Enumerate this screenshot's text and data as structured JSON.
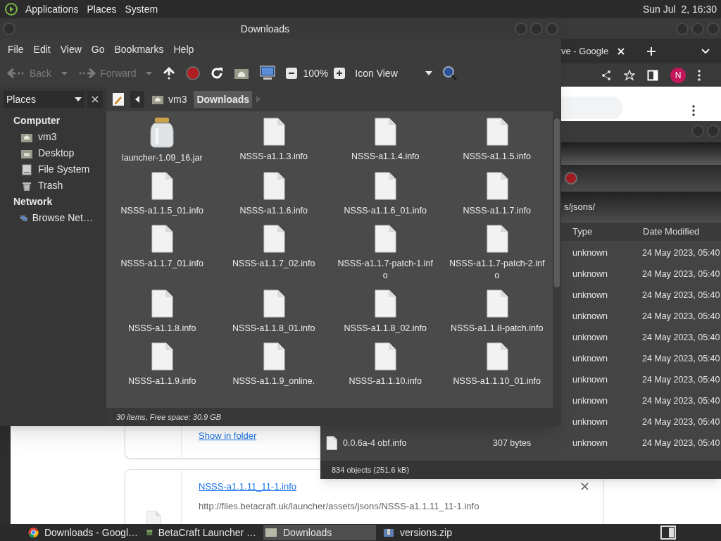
{
  "top_panel": {
    "menus": [
      "Applications",
      "Places",
      "System"
    ],
    "clock": "Sun Jul  2, 16:30"
  },
  "browser": {
    "tab_title": "ve - Google",
    "avatar": "N",
    "downloads": [
      {
        "kind": "action",
        "link": "Show in folder"
      },
      {
        "kind": "file",
        "link": "NSSS-a1.1.11_11-1.info",
        "url": "http://files.betacraft.uk/launcher/assets/jsons/NSSS-a1.1.11_11-1.info"
      }
    ]
  },
  "list_window": {
    "location": "s/jsons/",
    "columns": [
      "Type",
      "Date Modified"
    ],
    "rows": [
      {
        "type": "unknown",
        "date": "24 May 2023, 05:40"
      },
      {
        "type": "unknown",
        "date": "24 May 2023, 05:40"
      },
      {
        "type": "unknown",
        "date": "24 May 2023, 05:40"
      },
      {
        "type": "unknown",
        "date": "24 May 2023, 05:40"
      },
      {
        "type": "unknown",
        "date": "24 May 2023, 05:40"
      },
      {
        "type": "unknown",
        "date": "24 May 2023, 05:40"
      },
      {
        "type": "unknown",
        "date": "24 May 2023, 05:40"
      },
      {
        "type": "unknown",
        "date": "24 May 2023, 05:40"
      },
      {
        "type": "unknown",
        "date": "24 May 2023, 05:40"
      },
      {
        "name": "0.0.6a-4 obf.info",
        "size": "307 bytes",
        "type": "unknown",
        "date": "24 May 2023, 05:40"
      }
    ],
    "status": "834 objects (251.6 kB)"
  },
  "file_manager": {
    "title": "Downloads",
    "menus": [
      "File",
      "Edit",
      "View",
      "Go",
      "Bookmarks",
      "Help"
    ],
    "toolbar": {
      "back": {
        "label": "Back",
        "disabled": true
      },
      "forward": {
        "label": "Forward",
        "disabled": true
      },
      "zoom": "100%",
      "view": "Icon View"
    },
    "side_pane": {
      "title": "Places",
      "groups": [
        {
          "heading": "Computer",
          "items": [
            {
              "label": "vm3",
              "kind": "home"
            },
            {
              "label": "Desktop",
              "kind": "desktop"
            },
            {
              "label": "File System",
              "kind": "drive"
            },
            {
              "label": "Trash",
              "kind": "trash"
            }
          ]
        },
        {
          "heading": "Network",
          "items": [
            {
              "label": "Browse Net…",
              "kind": "network"
            }
          ]
        }
      ]
    },
    "path": [
      {
        "label": "vm3",
        "kind": "home",
        "selected": false
      },
      {
        "label": "Downloads",
        "kind": "plain",
        "selected": true
      }
    ],
    "files": [
      {
        "name": "launcher-1.09_16.jar",
        "kind": "jar"
      },
      {
        "name": "NSSS-a1.1.3.info",
        "kind": "file"
      },
      {
        "name": "NSSS-a1.1.4.info",
        "kind": "file"
      },
      {
        "name": "NSSS-a1.1.5.info",
        "kind": "file"
      },
      {
        "name": "NSSS-a1.1.5_01.info",
        "kind": "file"
      },
      {
        "name": "NSSS-a1.1.6.info",
        "kind": "file"
      },
      {
        "name": "NSSS-a1.1.6_01.info",
        "kind": "file"
      },
      {
        "name": "NSSS-a1.1.7.info",
        "kind": "file"
      },
      {
        "name": "NSSS-a1.1.7_01.info",
        "kind": "file"
      },
      {
        "name": "NSSS-a1.1.7_02.info",
        "kind": "file"
      },
      {
        "name": "NSSS-a1.1.7-patch-1.info",
        "kind": "file"
      },
      {
        "name": "NSSS-a1.1.7-patch-2.info",
        "kind": "file"
      },
      {
        "name": "NSSS-a1.1.8.info",
        "kind": "file"
      },
      {
        "name": "NSSS-a1.1.8_01.info",
        "kind": "file"
      },
      {
        "name": "NSSS-a1.1.8_02.info",
        "kind": "file"
      },
      {
        "name": "NSSS-a1.1.8-patch.info",
        "kind": "file"
      },
      {
        "name": "NSSS-a1.1.9.info",
        "kind": "file"
      },
      {
        "name": "NSSS-a1.1.9_online.",
        "kind": "file"
      },
      {
        "name": "NSSS-a1.1.10.info",
        "kind": "file"
      },
      {
        "name": "NSSS-a1.1.10_01.info",
        "kind": "file"
      }
    ],
    "status": "30 items, Free space: 30.9 GB"
  },
  "taskbar": [
    {
      "label": "Downloads - Googl…",
      "kind": "browser",
      "selected": false
    },
    {
      "label": "BetaCraft Launcher …",
      "kind": "app",
      "selected": false
    },
    {
      "label": "Downloads",
      "kind": "folder",
      "selected": true
    },
    {
      "label": "versions.zip",
      "kind": "archive",
      "selected": false
    }
  ]
}
